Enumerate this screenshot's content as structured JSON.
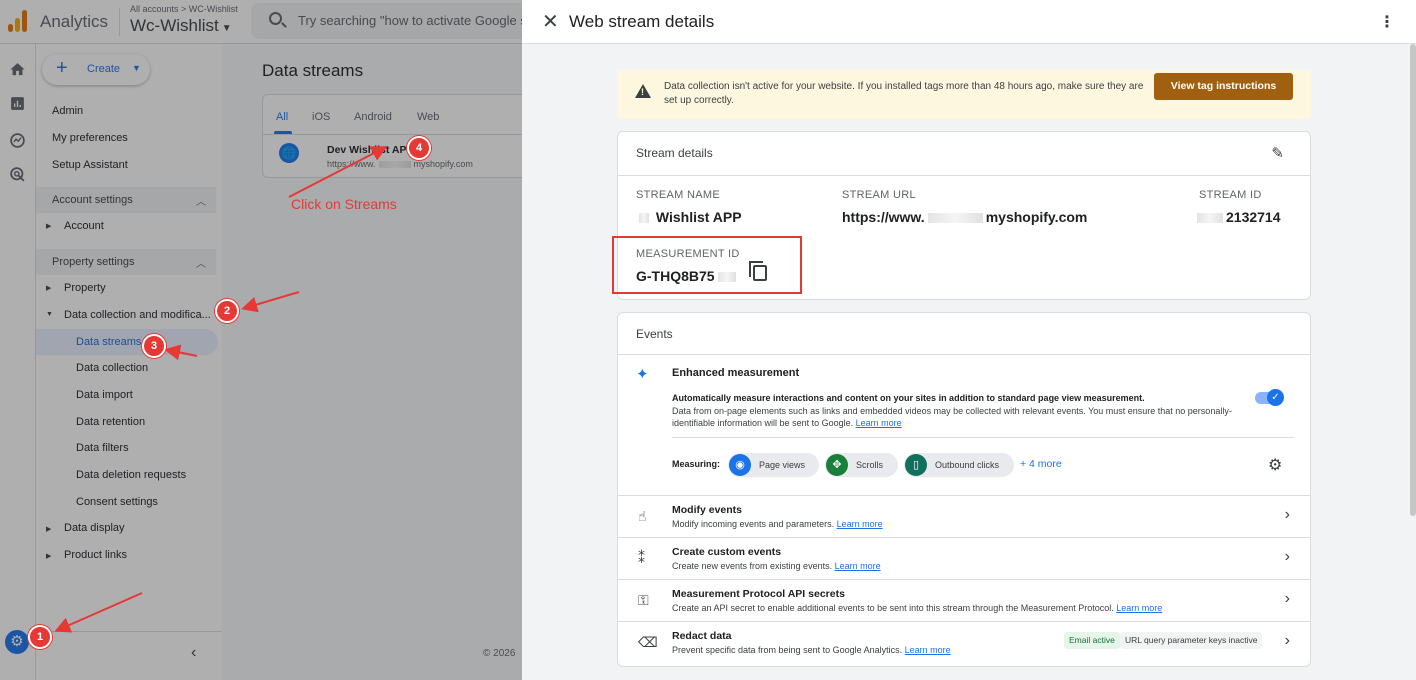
{
  "header": {
    "app_name": "Analytics",
    "account_breadcrumb": "All accounts > WC-Wishlist",
    "property_name": "Wc-Wishlist",
    "search_placeholder": "Try searching \"how to activate Google s"
  },
  "sidebar": {
    "create_label": "Create",
    "items": [
      "Admin",
      "My preferences",
      "Setup Assistant"
    ],
    "account_settings": "Account settings",
    "account": "Account",
    "property_settings": "Property settings",
    "property": "Property",
    "data_collection": "Data collection and modifica...",
    "sub_items": [
      "Data streams",
      "Data collection",
      "Data import",
      "Data retention",
      "Data filters",
      "Data deletion requests",
      "Consent settings"
    ],
    "data_display": "Data display",
    "product_links": "Product links"
  },
  "main": {
    "title": "Data streams",
    "tabs": [
      "All",
      "iOS",
      "Android",
      "Web"
    ],
    "stream_name": "Dev Wishlist API",
    "stream_url_prefix": "https://www.",
    "stream_url_suffix": "myshopify.com",
    "copyright": "© 2026"
  },
  "annotations": {
    "badges": [
      "1",
      "2",
      "3",
      "4"
    ],
    "click_text": "Click on Streams",
    "color": "#e53935"
  },
  "drawer": {
    "title": "Web stream details",
    "warning_text": "Data collection isn't active for your website. If you installed tags more than 48 hours ago, make sure they are set up correctly.",
    "warning_button": "View tag instructions",
    "stream_details": {
      "title": "Stream details",
      "name_label": "STREAM NAME",
      "name_value": "Wishlist APP",
      "url_label": "STREAM URL",
      "url_prefix": "https://www.",
      "url_suffix": "myshopify.com",
      "id_label": "STREAM ID",
      "id_value": "2132714",
      "measurement_label": "MEASUREMENT ID",
      "measurement_value": "G-THQ8B75"
    },
    "events": {
      "title": "Events",
      "enhanced_title": "Enhanced measurement",
      "enhanced_desc1": "Automatically measure interactions and content on your sites in addition to standard page view measurement.",
      "enhanced_desc2": "Data from on-page elements such as links and embedded videos may be collected with relevant events. You must ensure that no personally-identifiable information will be sent to Google.",
      "learn_more": "Learn more",
      "measuring_label": "Measuring:",
      "chips": [
        "Page views",
        "Scrolls",
        "Outbound clicks"
      ],
      "more": "+ 4 more",
      "rows": [
        {
          "title": "Modify events",
          "desc": "Modify incoming events and parameters."
        },
        {
          "title": "Create custom events",
          "desc": "Create new events from existing events."
        },
        {
          "title": "Measurement Protocol API secrets",
          "desc": "Create an API secret to enable additional events to be sent into this stream through the Measurement Protocol."
        },
        {
          "title": "Redact data",
          "desc": "Prevent specific data from being sent to Google Analytics."
        }
      ],
      "redact_email": "Email active",
      "redact_query": "URL query parameter keys inactive"
    }
  },
  "icons": [
    "home-icon",
    "reports-icon",
    "explore-icon",
    "advertising-icon",
    "settings-gear-icon",
    "globe-icon",
    "close-icon",
    "more-vert-icon",
    "warning-icon",
    "edit-icon",
    "copy-icon",
    "sparkle-icon",
    "eye-icon",
    "scroll-icon",
    "mouse-icon",
    "settings-icon",
    "touch-icon",
    "click-icon",
    "key-icon",
    "eraser-icon",
    "chevron-right-icon"
  ]
}
